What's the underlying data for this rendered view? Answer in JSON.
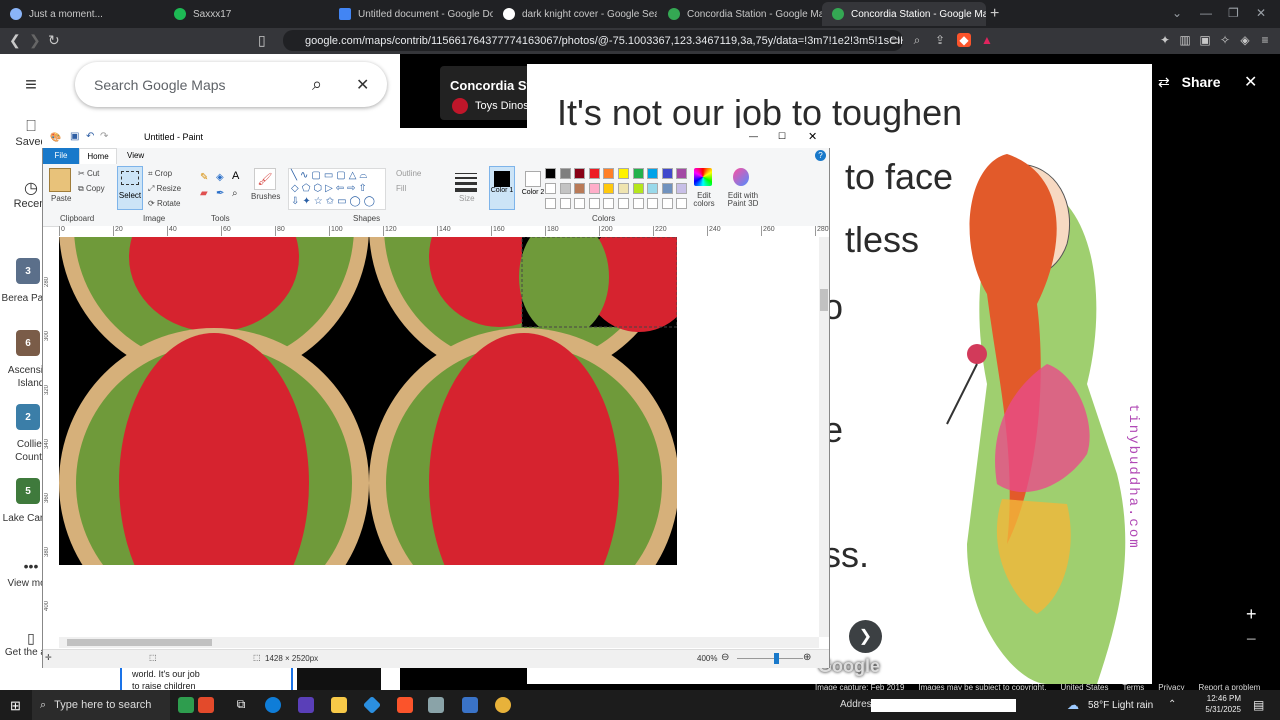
{
  "browser": {
    "tabs": [
      {
        "label": "Just a moment...",
        "color": "#8ab4f8"
      },
      {
        "label": "Saxxx17",
        "color": "#1db954"
      },
      {
        "label": "Untitled document - Google Docs",
        "color": "#4285f4"
      },
      {
        "label": "dark knight cover - Google Search",
        "color": "#ffffff"
      },
      {
        "label": "Concordia Station - Google Maps",
        "color": "#34a853"
      },
      {
        "label": "Concordia Station - Google Ma",
        "color": "#34a853",
        "active": true
      }
    ],
    "url": "google.com/maps/contrib/115661764377774163067/photos/@-75.1003367,123.3467119,3a,75y/data=!3m7!1e2!3m5!1sCIHM0ogKEICAgI..."
  },
  "maps": {
    "search_placeholder": "Search Google Maps",
    "rail": {
      "saved": "Saved",
      "recent": "Recent",
      "places": [
        {
          "badge": "3",
          "label": "Berea Parma",
          "color": "#5b6f8a"
        },
        {
          "badge": "6",
          "label": "Ascension Island",
          "color": "#7a5c48"
        },
        {
          "badge": "2",
          "label": "Collier County",
          "color": "#3b7ea8"
        },
        {
          "badge": "5",
          "label": "Lake Carmel",
          "color": "#3f7a3c"
        }
      ],
      "view_more": "View more",
      "get_app": "Get the app"
    },
    "photo": {
      "title": "Concordia Station",
      "author": "Toys Dinosaur Rexs Suprise Fun",
      "share": "Share",
      "poster_lines": [
        "It's not our job to toughen",
        "to face",
        "tless",
        "o",
        "e",
        "ss."
      ],
      "watermark": "tinybuddha.com",
      "google_logo": "Google",
      "footer": {
        "capture": "Image capture: Feb 2019",
        "disclaimer": "Images may be subject to copyright.",
        "region": "United States",
        "terms": "Terms",
        "privacy": "Privacy",
        "report": "Report a problem"
      }
    },
    "results_snippet": [
      "world. It's our job",
      "to raise children"
    ]
  },
  "paint": {
    "title": "Untitled - Paint",
    "tabs": {
      "file": "File",
      "home": "Home",
      "view": "View"
    },
    "clipboard": {
      "paste": "Paste",
      "cut": "Cut",
      "copy": "Copy",
      "group": "Clipboard"
    },
    "image": {
      "select": "Select",
      "crop": "Crop",
      "resize": "Resize",
      "rotate": "Rotate",
      "group": "Image"
    },
    "tools": {
      "group": "Tools",
      "brushes": "Brushes"
    },
    "shapes": {
      "group": "Shapes",
      "outline": "Outline",
      "fill": "Fill"
    },
    "size_label": "Size",
    "color1": "Color 1",
    "color2": "Color 2",
    "colors_group": "Colors",
    "edit_colors": "Edit colors",
    "edit_paint3d": "Edit with Paint 3D",
    "palette": [
      "#000000",
      "#7f7f7f",
      "#880015",
      "#ed1c24",
      "#ff7f27",
      "#fff200",
      "#22b14c",
      "#00a2e8",
      "#3f48cc",
      "#a349a4",
      "#ffffff",
      "#c3c3c3",
      "#b97a57",
      "#ffaec9",
      "#ffc90e",
      "#efe4b0",
      "#b5e61d",
      "#99d9ea",
      "#7092be",
      "#c8bfe7"
    ],
    "ruler_ticks": [
      "0",
      "20",
      "40",
      "60",
      "80",
      "100",
      "120",
      "140",
      "160",
      "180",
      "200",
      "220",
      "240",
      "260",
      "280"
    ],
    "ruler_left": [
      "280",
      "300",
      "320",
      "340",
      "360",
      "380",
      "400"
    ],
    "dimensions": "1428 × 2520px",
    "zoom": "400%"
  },
  "taskbar": {
    "search": "Type here to search",
    "address_label": "Address",
    "weather": "58°F  Light rain",
    "time": "12:46 PM",
    "date": "5/31/2025"
  }
}
